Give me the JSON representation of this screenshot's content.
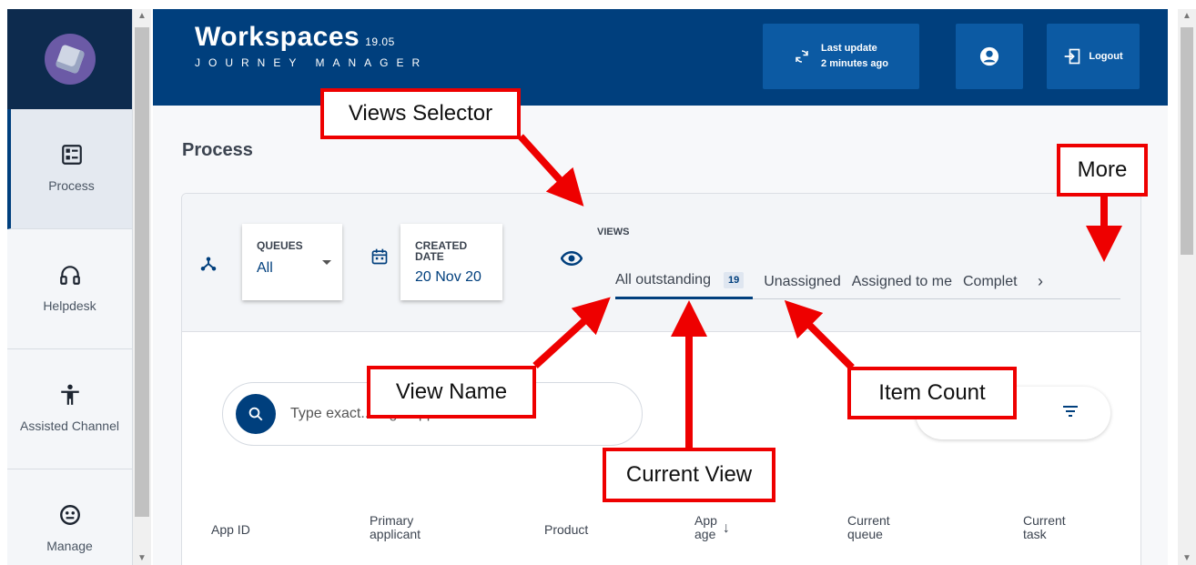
{
  "app": {
    "title": "Workspaces",
    "version": "19.05",
    "subtitle": "JOURNEY MANAGER",
    "last_update_line1": "Last update",
    "last_update_line2": "2 minutes ago",
    "logout_label": "Logout"
  },
  "sidebar": {
    "items": [
      {
        "label": "Process",
        "icon": "process-icon"
      },
      {
        "label": "Helpdesk",
        "icon": "headset-icon"
      },
      {
        "label": "Assisted Channel",
        "icon": "accessibility-icon"
      },
      {
        "label": "Manage",
        "icon": "manage-icon"
      }
    ]
  },
  "page": {
    "title": "Process"
  },
  "filters": {
    "queues_label": "QUEUES",
    "queues_value": "All",
    "created_label_line1": "CREATED",
    "created_label_line2": "DATE",
    "created_value": "20 Nov 20"
  },
  "views": {
    "label": "VIEWS",
    "tabs": [
      {
        "label": "All outstanding",
        "count": "19",
        "active": true
      },
      {
        "label": "Unassigned"
      },
      {
        "label": "Assigned to me"
      },
      {
        "label": "Complet"
      }
    ]
  },
  "search": {
    "placeholder": "Type exact... e.g. \"apple\""
  },
  "table": {
    "columns": [
      {
        "line1": "App ID",
        "line2": ""
      },
      {
        "line1": "Primary",
        "line2": "applicant"
      },
      {
        "line1": "Product",
        "line2": ""
      },
      {
        "line1": "App",
        "line2": "age"
      },
      {
        "line1": "Current",
        "line2": "queue"
      },
      {
        "line1": "Current",
        "line2": "task"
      }
    ]
  },
  "annotations": {
    "views_selector": "Views Selector",
    "more": "More",
    "view_name": "View Name",
    "item_count": "Item Count",
    "current_view": "Current View"
  },
  "colors": {
    "header_bg": "#003f7d",
    "header_button": "#0c5aa3",
    "callout_border": "#ee0000"
  }
}
